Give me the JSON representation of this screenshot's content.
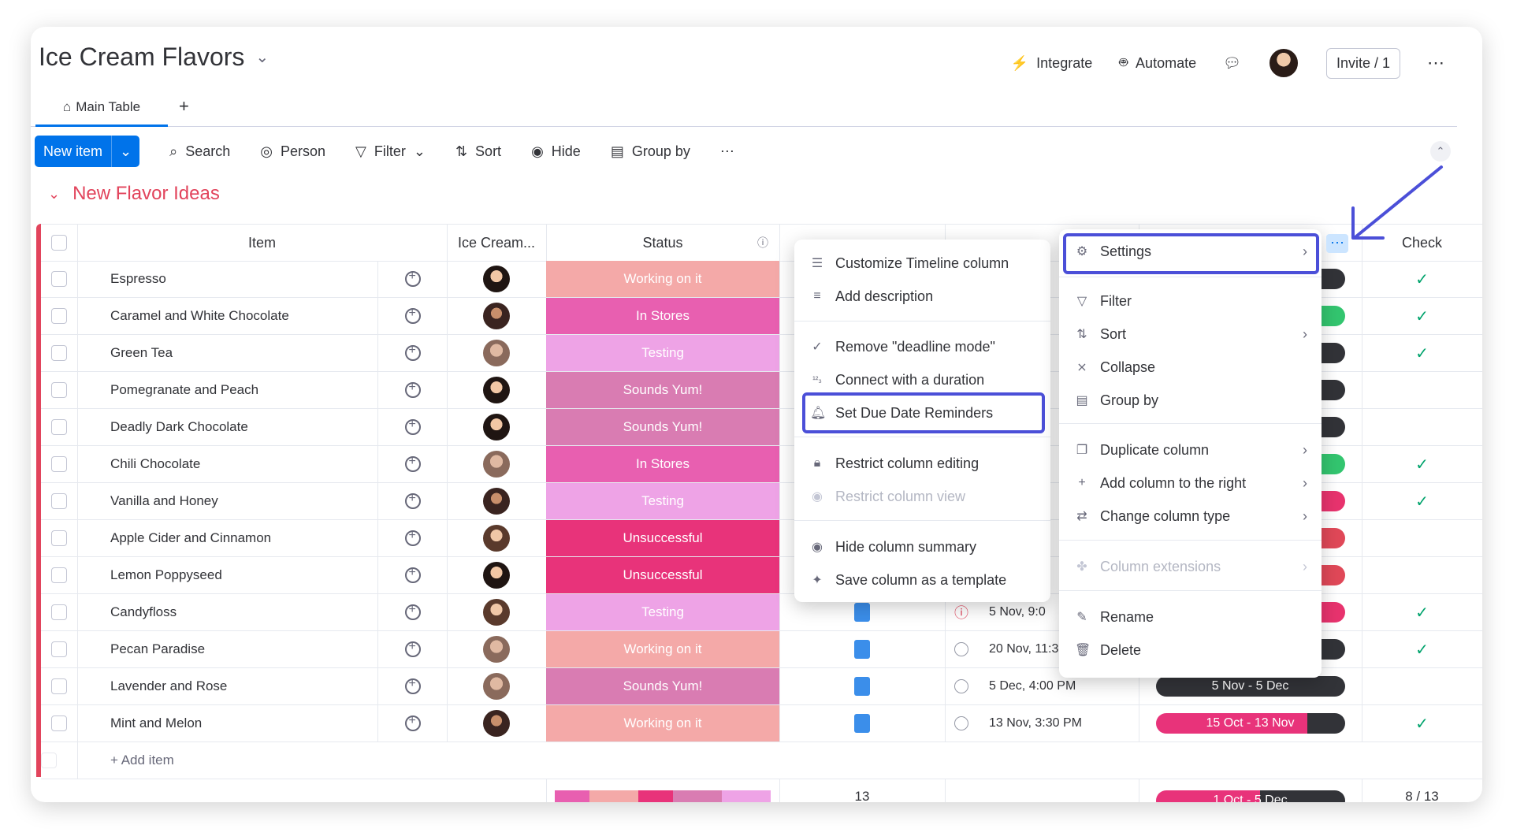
{
  "board": {
    "title": "Ice Cream Flavors"
  },
  "topbar": {
    "integrate": "Integrate",
    "automate": "Automate",
    "invite": "Invite / 1"
  },
  "tabs": {
    "main": "Main Table",
    "add": "+"
  },
  "toolbar": {
    "new_item": "New item",
    "search": "Search",
    "person": "Person",
    "filter": "Filter",
    "sort": "Sort",
    "hide": "Hide",
    "group_by": "Group by"
  },
  "group": {
    "title": "New Flavor Ideas",
    "add_item": "+ Add item"
  },
  "columns": {
    "item": "Item",
    "owner": "Ice Cream...",
    "status": "Status",
    "check": "Check"
  },
  "rows": [
    {
      "name": "Espresso",
      "status": "Working on it",
      "status_color": "#f4a9a8",
      "check": "✓",
      "timeline_color": "#323338",
      "av": "a"
    },
    {
      "name": "Caramel and White Chocolate",
      "status": "In Stores",
      "status_color": "#e85fb0",
      "check": "✓",
      "timeline_color": "#33c56f",
      "av": "b"
    },
    {
      "name": "Green Tea",
      "status": "Testing",
      "status_color": "#eea3e6",
      "check": "✓",
      "timeline_color": "#323338",
      "av": "c"
    },
    {
      "name": "Pomegranate and Peach",
      "status": "Sounds Yum!",
      "status_color": "#d97cb2",
      "check": "",
      "timeline_color": "#323338",
      "av": "a"
    },
    {
      "name": "Deadly Dark Chocolate",
      "status": "Sounds Yum!",
      "status_color": "#d97cb2",
      "check": "",
      "timeline_color": "#323338",
      "av": "a"
    },
    {
      "name": "Chili Chocolate",
      "status": "In Stores",
      "status_color": "#e85fb0",
      "check": "✓",
      "timeline_color": "#33c56f",
      "av": "c"
    },
    {
      "name": "Vanilla and Honey",
      "status": "Testing",
      "status_color": "#eea3e6",
      "check": "✓",
      "timeline_color": "#e8336e",
      "av": "b"
    },
    {
      "name": "Apple Cider and Cinnamon",
      "status": "Unsuccessful",
      "status_color": "#e8337a",
      "check": "",
      "timeline_color": "#e04858",
      "av": "d"
    },
    {
      "name": "Lemon Poppyseed",
      "status": "Unsuccessful",
      "status_color": "#e8337a",
      "check": "",
      "timeline_color": "#e04858",
      "av": "a"
    },
    {
      "name": "Candyfloss",
      "status": "Testing",
      "status_color": "#eea3e6",
      "check": "✓",
      "timeline_color": "#e8336e",
      "av": "d",
      "date": "5 Nov, 9:0"
    },
    {
      "name": "Pecan Paradise",
      "status": "Working on it",
      "status_color": "#f4a9a8",
      "check": "✓",
      "timeline_color": "#323338",
      "av": "c",
      "date": "20 Nov, 11:3"
    },
    {
      "name": "Lavender and Rose",
      "status": "Sounds Yum!",
      "status_color": "#d97cb2",
      "check": "",
      "timeline_color": "#323338",
      "av": "c",
      "date": "5 Dec, 4:00 PM",
      "timeline": "5 Nov - 5 Dec"
    },
    {
      "name": "Mint and Melon",
      "status": "Working on it",
      "status_color": "#f4a9a8",
      "check": "✓",
      "timeline_color": "#e8337a",
      "av": "b",
      "date": "13 Nov, 3:30 PM",
      "timeline": "15 Oct - 13 Nov"
    }
  ],
  "summary": {
    "files": "13",
    "timeline": "1 Oct - 5 Dec",
    "check": "8 / 13"
  },
  "menu_left": {
    "items": [
      "Customize Timeline column",
      "Add description",
      "Remove \"deadline mode\"",
      "Connect with a duration",
      "Set Due Date Reminders",
      "Restrict column editing",
      "Restrict column view",
      "Hide column summary",
      "Save column as a template"
    ]
  },
  "menu_right": {
    "items": [
      "Settings",
      "Filter",
      "Sort",
      "Collapse",
      "Group by",
      "Duplicate column",
      "Add column to the right",
      "Change column type",
      "Column extensions",
      "Rename",
      "Delete"
    ]
  },
  "colors": {
    "accent": "#0073ea",
    "group": "#e2445c",
    "highlight": "#4b4fd8"
  }
}
